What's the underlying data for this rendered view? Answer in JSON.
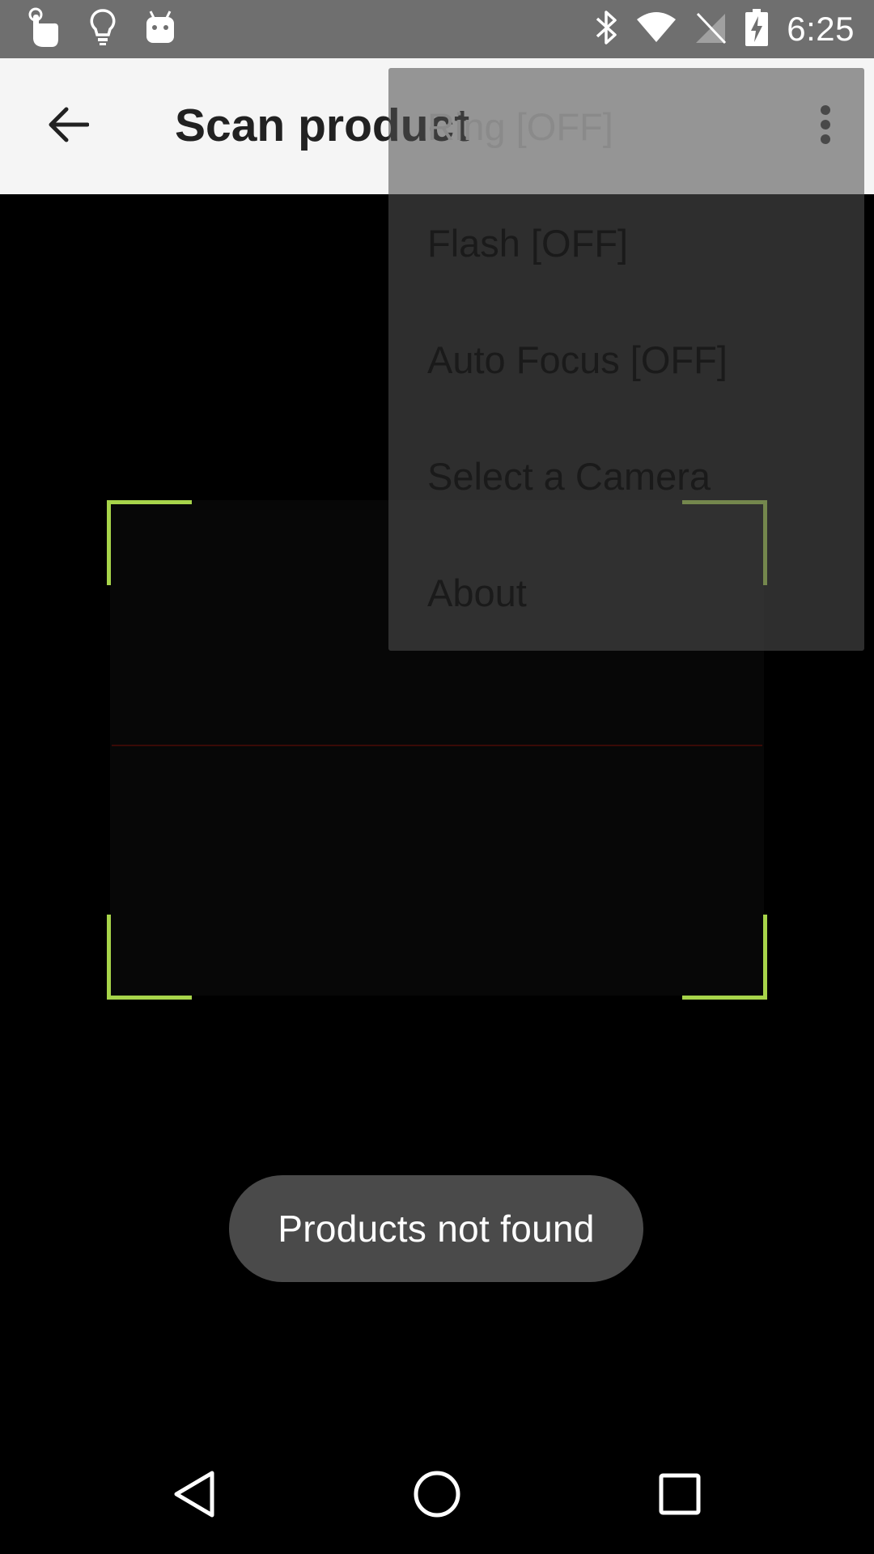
{
  "status_bar": {
    "time": "6:25",
    "left_icons": [
      "touch-icon",
      "lightbulb-icon",
      "android-icon"
    ],
    "right_icons": [
      "bluetooth-icon",
      "wifi-icon",
      "no-sim-icon",
      "battery-charging-icon"
    ]
  },
  "app_bar": {
    "title": "Scan product",
    "back_icon": "arrow-back-icon",
    "overflow_icon": "more-vert-icon"
  },
  "menu": {
    "items": [
      {
        "label": "Ring [OFF]"
      },
      {
        "label": "Flash [OFF]"
      },
      {
        "label": "Auto Focus [OFF]"
      },
      {
        "label": "Select a Camera"
      },
      {
        "label": "About"
      }
    ]
  },
  "scanner": {
    "frame_color": "#a7d44a",
    "laser_color": "#3a0a06"
  },
  "toast": {
    "text": "Products not found"
  },
  "nav_bar": {
    "back_icon": "nav-back-icon",
    "home_icon": "nav-home-icon",
    "recents_icon": "nav-recents-icon"
  }
}
